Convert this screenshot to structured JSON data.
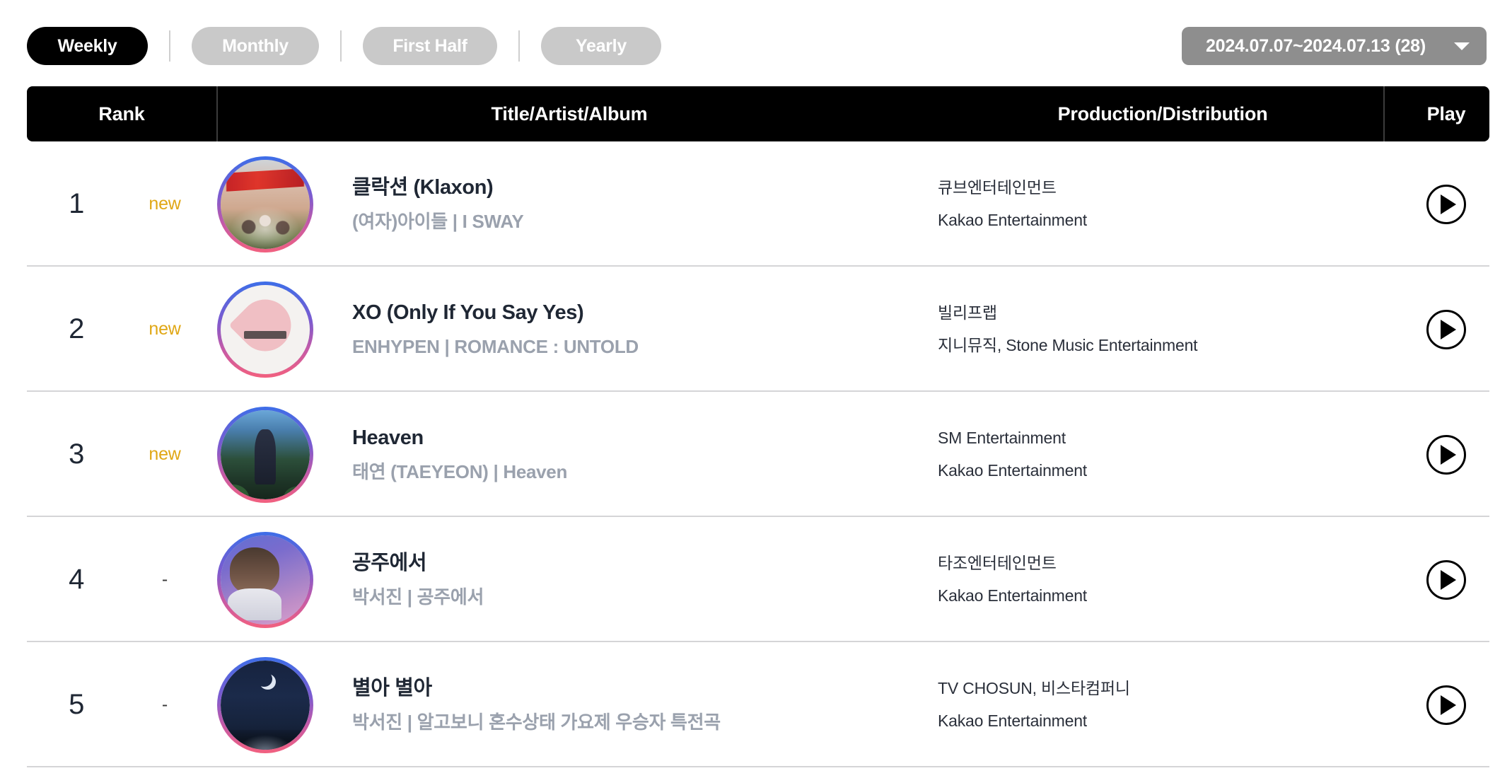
{
  "toolbar": {
    "period_tabs": [
      {
        "label": "Weekly",
        "active": true
      },
      {
        "label": "Monthly",
        "active": false
      },
      {
        "label": "First Half",
        "active": false
      },
      {
        "label": "Yearly",
        "active": false
      }
    ],
    "date_range": {
      "label": "2024.07.07~2024.07.13 (28)",
      "caret_icon": "chevron-down-icon"
    }
  },
  "table": {
    "columns": {
      "rank": "Rank",
      "title": "Title/Artist/Album",
      "production": "Production/Distribution",
      "play": "Play"
    },
    "rows": [
      {
        "rank": "1",
        "change": "new",
        "change_type": "new",
        "title": "클락션 (Klaxon)",
        "subtitle": "(여자)아이들 | I SWAY",
        "production": "큐브엔터테인먼트",
        "distribution": "Kakao Entertainment",
        "play_icon": "play-icon"
      },
      {
        "rank": "2",
        "change": "new",
        "change_type": "new",
        "title": "XO (Only If You Say Yes)",
        "subtitle": "ENHYPEN | ROMANCE : UNTOLD",
        "production": "빌리프랩",
        "distribution": "지니뮤직, Stone Music Entertainment",
        "play_icon": "play-icon"
      },
      {
        "rank": "3",
        "change": "new",
        "change_type": "new",
        "title": "Heaven",
        "subtitle": "태연 (TAEYEON) | Heaven",
        "production": "SM Entertainment",
        "distribution": "Kakao Entertainment",
        "play_icon": "play-icon"
      },
      {
        "rank": "4",
        "change": "-",
        "change_type": "same",
        "title": "공주에서",
        "subtitle": "박서진 | 공주에서",
        "production": "타조엔터테인먼트",
        "distribution": "Kakao Entertainment",
        "play_icon": "play-icon"
      },
      {
        "rank": "5",
        "change": "-",
        "change_type": "same",
        "title": "별아 별아",
        "subtitle": "박서진 | 알고보니 혼수상태 가요제 우승자 특전곡",
        "production": "TV CHOSUN, 비스타컴퍼니",
        "distribution": "Kakao Entertainment",
        "play_icon": "play-icon"
      }
    ]
  },
  "colors": {
    "active_tab_bg": "#000000",
    "inactive_tab_bg": "#c9c9c9",
    "date_select_bg": "#8e8e8e",
    "header_bg": "#000000",
    "new_badge": "#e0a715",
    "title_text": "#1f2734",
    "subtitle_text": "#9aa1ad",
    "row_divider": "#d5d5d7"
  }
}
